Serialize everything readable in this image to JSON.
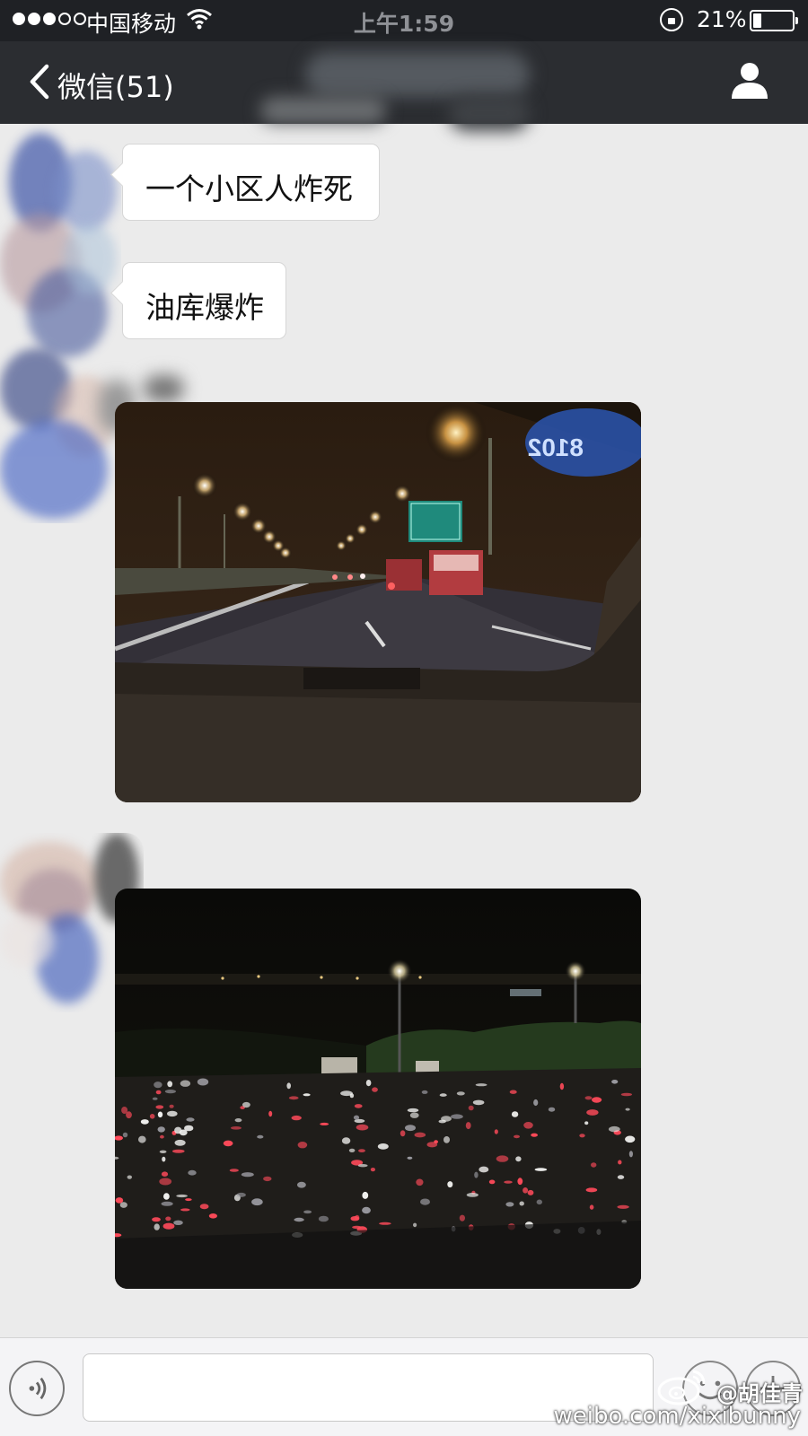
{
  "status_bar": {
    "carrier": "中国移动",
    "time": "上午1:59",
    "battery_percent": "21%",
    "battery_level": 0.21,
    "signal_bars_filled": 3,
    "signal_bars_total": 5
  },
  "nav_bar": {
    "back_label": "微信(51)",
    "back_icon": "chevron-left-icon",
    "profile_icon": "person-icon"
  },
  "messages": [
    {
      "type": "text",
      "text": "一个小区人炸死"
    },
    {
      "type": "text",
      "text": "油库爆炸"
    },
    {
      "type": "image",
      "sign_text": "8102"
    },
    {
      "type": "image"
    }
  ],
  "input_bar": {
    "message_value": "",
    "voice_icon": "voice-icon",
    "emoji_icon": "emoji-icon",
    "more_icon": "plus-icon"
  },
  "watermark": {
    "handle": "@胡佳青",
    "url": "weibo.com/xixibunny"
  },
  "colors": {
    "status_bar_bg": "#1f2125",
    "nav_bar_bg": "#2b2d31",
    "chat_bg": "#ebebeb",
    "bubble_bg": "#ffffff"
  }
}
